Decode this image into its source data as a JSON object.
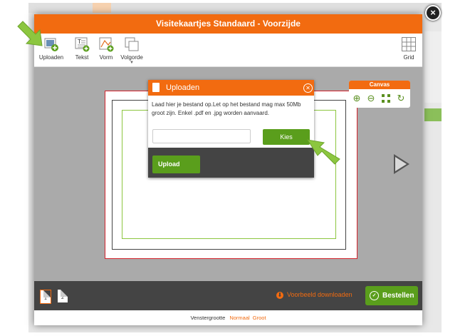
{
  "modal": {
    "title": "Visitekaartjes Standaard - Voorzijde",
    "close_symbol": "×"
  },
  "toolbar": {
    "items": [
      {
        "label": "Uploaden",
        "icon": "upload-image-icon"
      },
      {
        "label": "Tekst",
        "icon": "text-icon"
      },
      {
        "label": "Vorm",
        "icon": "shape-icon"
      },
      {
        "label": "Volgorde",
        "icon": "order-icon"
      }
    ],
    "grid_label": "Grid"
  },
  "canvas_panel": {
    "title": "Canvas",
    "icons": [
      "zoom-in-icon",
      "zoom-out-icon",
      "fit-icon",
      "rotate-icon"
    ]
  },
  "upload_dialog": {
    "title": "Uploaden",
    "message": "Laad hier je bestand op.Let op het bestand mag max 50Mb groot zijn. Enkel .pdf en .jpg worden aanvaard.",
    "file_value": "",
    "choose_label": "Kies",
    "upload_label": "Upload"
  },
  "bottombar": {
    "pages": [
      "1",
      "2"
    ],
    "download_label": "Voorbeeld downloaden",
    "order_label": "Bestellen"
  },
  "footer": {
    "label": "Venstergrootte",
    "options": [
      "Normaal",
      "Groot"
    ]
  },
  "colors": {
    "accent": "#f26b10",
    "green": "#5a9e1c",
    "dark": "#444444",
    "pointer_arrow": "#8cc63f"
  }
}
